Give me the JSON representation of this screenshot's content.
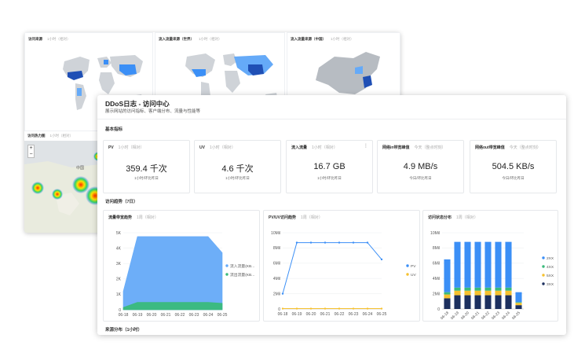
{
  "back": {
    "panels": [
      {
        "title": "访问来源",
        "sub": "1小时（相对）"
      },
      {
        "title": "流入流量来源（世界）",
        "sub": "1小时（相对）"
      },
      {
        "title": "流入流量来源（中国）",
        "sub": "1小时（相对）"
      }
    ],
    "heat": {
      "title": "访问热力图",
      "sub": "1小时（相对）",
      "zoom_in": "+",
      "zoom_out": "−",
      "city": "中国"
    }
  },
  "front": {
    "title": "DDoS日志 - 访问中心",
    "subtitle": "展示网站的访问指标、客户端分布、流量与性能等",
    "section_basic": "基本指标",
    "section_trend": "访问趋势（7日）",
    "section_source": "来源分布（1小时）",
    "cards": [
      {
        "label": "PV",
        "range": "1小时（相对）",
        "value": "359.4 千次",
        "compare": "1小时/环比昨日"
      },
      {
        "label": "UV",
        "range": "1小时（相对）",
        "value": "4.6 千次",
        "compare": "1小时/环比昨日"
      },
      {
        "label": "流入流量",
        "range": "1小时（相对）",
        "value": "16.7 GB",
        "compare": "1小时/环比昨日",
        "more": "⋮"
      },
      {
        "label": "网络in带宽峰值",
        "range": "今天（整点时刻）",
        "value": "4.9 MB/s",
        "compare": "今日/环比昨日"
      },
      {
        "label": "网络out带宽峰值",
        "range": "今天（整点时刻）",
        "value": "504.5 KB/s",
        "compare": "今日/环比昨日"
      }
    ]
  },
  "colors": {
    "blue": "#3b8ff6",
    "blue_fill": "#65aaf8",
    "green": "#3aba7b",
    "yellow": "#f5c12f",
    "navy": "#1c2f5e",
    "map_gray": "#cfd3d8"
  },
  "chart_data": [
    {
      "type": "area",
      "title": "流量带宽趋势",
      "range": "1周（相对）",
      "categories": [
        "06-18",
        "06-19",
        "06-20",
        "06-21",
        "06-22",
        "06-23",
        "06-24",
        "06-25"
      ],
      "ylim": [
        0,
        5000
      ],
      "ytick_labels": [
        "0",
        "1K",
        "2K",
        "3K",
        "4K",
        "5K"
      ],
      "series": [
        {
          "name": "流入流量(KB...",
          "values": [
            1200,
            4750,
            4750,
            4750,
            4750,
            4750,
            4750,
            3700
          ],
          "color": "#65aaf8"
        },
        {
          "name": "流出流量(KB...",
          "values": [
            150,
            480,
            480,
            480,
            480,
            480,
            480,
            420
          ],
          "color": "#3aba7b"
        }
      ]
    },
    {
      "type": "line",
      "title": "PV/UV访问趋势",
      "range": "1周（相对）",
      "categories": [
        "06-18",
        "06-19",
        "06-20",
        "06-21",
        "06-22",
        "06-23",
        "06-24",
        "06-25"
      ],
      "ylim": [
        0,
        10000000
      ],
      "ytick_labels": [
        "0",
        "2Mil",
        "4Mil",
        "6Mil",
        "8Mil",
        "10Mil"
      ],
      "series": [
        {
          "name": "PV",
          "values": [
            2000000,
            8700000,
            8700000,
            8700000,
            8700000,
            8700000,
            8700000,
            6500000
          ],
          "color": "#3b8ff6"
        },
        {
          "name": "UV",
          "values": [
            50000,
            50000,
            50000,
            50000,
            50000,
            50000,
            50000,
            50000
          ],
          "color": "#f5c12f"
        }
      ]
    },
    {
      "type": "bar",
      "title": "访问状态分布",
      "range": "1周（相对）",
      "categories": [
        "06-18",
        "06-19",
        "06-20",
        "06-21",
        "06-22",
        "06-23",
        "06-24",
        "06-25"
      ],
      "ylim": [
        0,
        10000000
      ],
      "ytick_labels": [
        "0",
        "2Mil",
        "4Mil",
        "6Mil",
        "8Mil",
        "10Mil"
      ],
      "stacked": true,
      "series": [
        {
          "name": "3XX",
          "values": [
            1400000,
            1800000,
            1800000,
            1800000,
            1800000,
            1800000,
            1800000,
            500000
          ],
          "color": "#1c2f5e"
        },
        {
          "name": "5XX",
          "values": [
            500000,
            600000,
            600000,
            600000,
            600000,
            600000,
            600000,
            300000
          ],
          "color": "#f5c12f"
        },
        {
          "name": "4XX",
          "values": [
            300000,
            400000,
            400000,
            400000,
            400000,
            400000,
            400000,
            100000
          ],
          "color": "#3aba7b"
        },
        {
          "name": "2XX",
          "values": [
            4300000,
            6000000,
            6000000,
            6000000,
            6000000,
            6000000,
            6000000,
            1300000
          ],
          "color": "#3b8ff6"
        }
      ],
      "legend_order": [
        "2XX",
        "4XX",
        "5XX",
        "3XX"
      ]
    }
  ]
}
